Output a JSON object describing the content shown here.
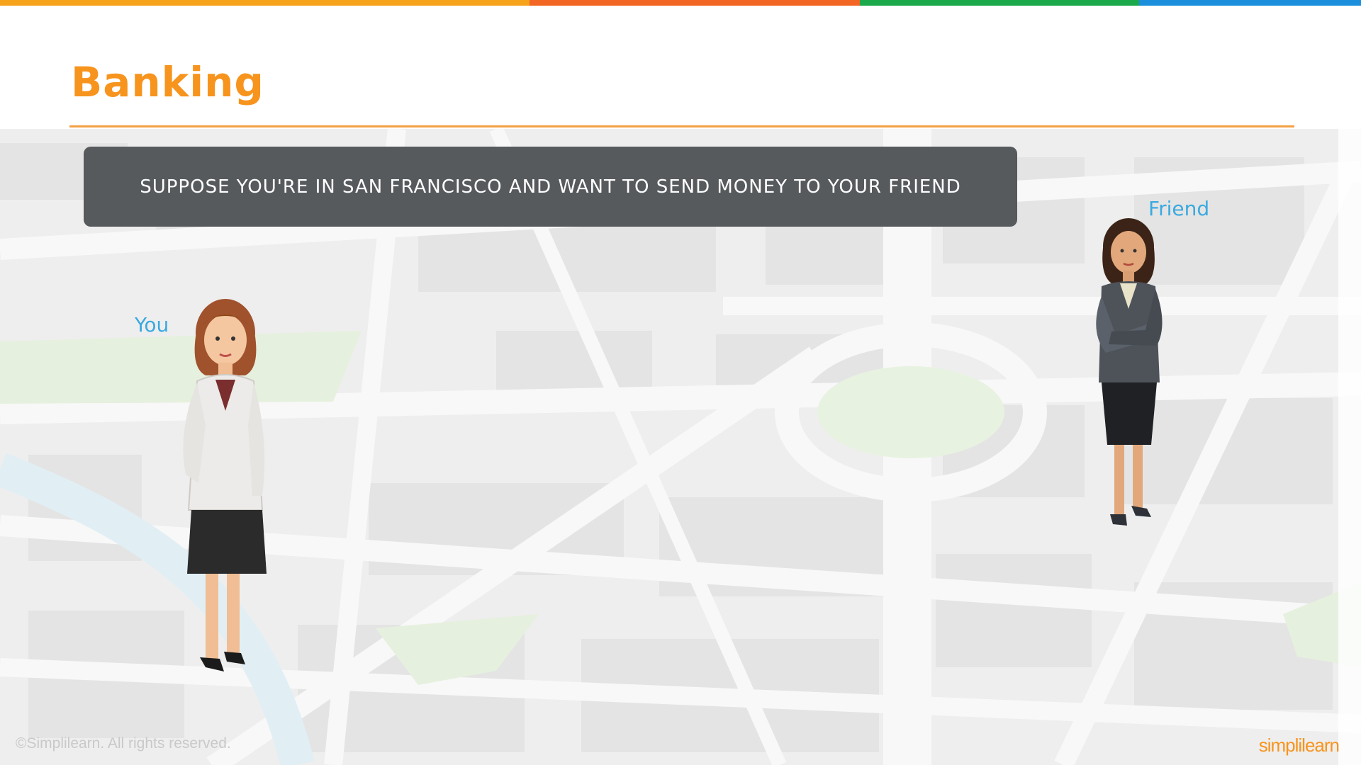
{
  "slide": {
    "title": "Banking",
    "banner_text": "SUPPOSE YOU'RE IN SAN FRANCISCO AND WANT TO SEND MONEY TO YOUR FRIEND",
    "label_you": "You",
    "label_friend": "Friend",
    "copyright": "©Simplilearn. All rights reserved.",
    "logo_text": "simplilearn"
  },
  "colors": {
    "title": "#f7941d",
    "rule": "#f4a044",
    "label": "#3aa9e0",
    "banner": "#575a5d",
    "topbar": [
      "#f7a21b",
      "#f26522",
      "#1ba94c",
      "#1c8fdc"
    ],
    "logo": "#f7941d"
  },
  "icons": {
    "you": "woman-white-blazer-figure",
    "friend": "woman-gray-suit-figure"
  }
}
